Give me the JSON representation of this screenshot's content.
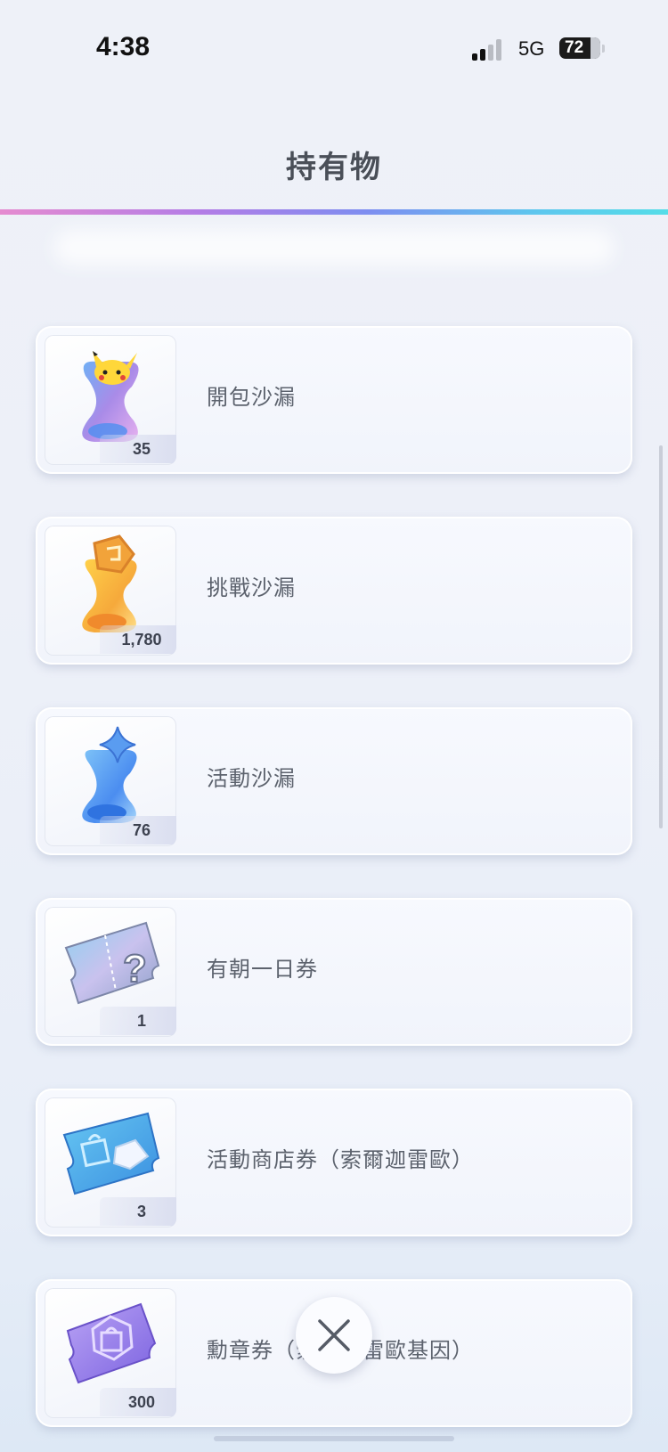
{
  "status_bar": {
    "time": "4:38",
    "network": "5G",
    "battery": "72",
    "battery_level": 0.72
  },
  "header": {
    "title": "持有物"
  },
  "items": [
    {
      "label": "開包沙漏",
      "count": "35",
      "icon": "pack-hourglass-icon"
    },
    {
      "label": "挑戰沙漏",
      "count": "1,780",
      "icon": "challenge-hourglass-icon"
    },
    {
      "label": "活動沙漏",
      "count": "76",
      "icon": "event-hourglass-icon"
    },
    {
      "label": "有朝一日券",
      "count": "1",
      "icon": "someday-ticket-icon"
    },
    {
      "label": "活動商店券（索爾迦雷歐）",
      "count": "3",
      "icon": "event-shop-ticket-icon"
    },
    {
      "label": "勳章券（索爾迦雷歐基因）",
      "count": "300",
      "icon": "medal-ticket-icon"
    }
  ],
  "close_button": {
    "icon": "close-icon"
  },
  "colors": {
    "rainbow_start": "#e58bd0",
    "rainbow_end": "#55dde8",
    "text": "#5c626d",
    "card_bg": "#f4f6fc"
  }
}
